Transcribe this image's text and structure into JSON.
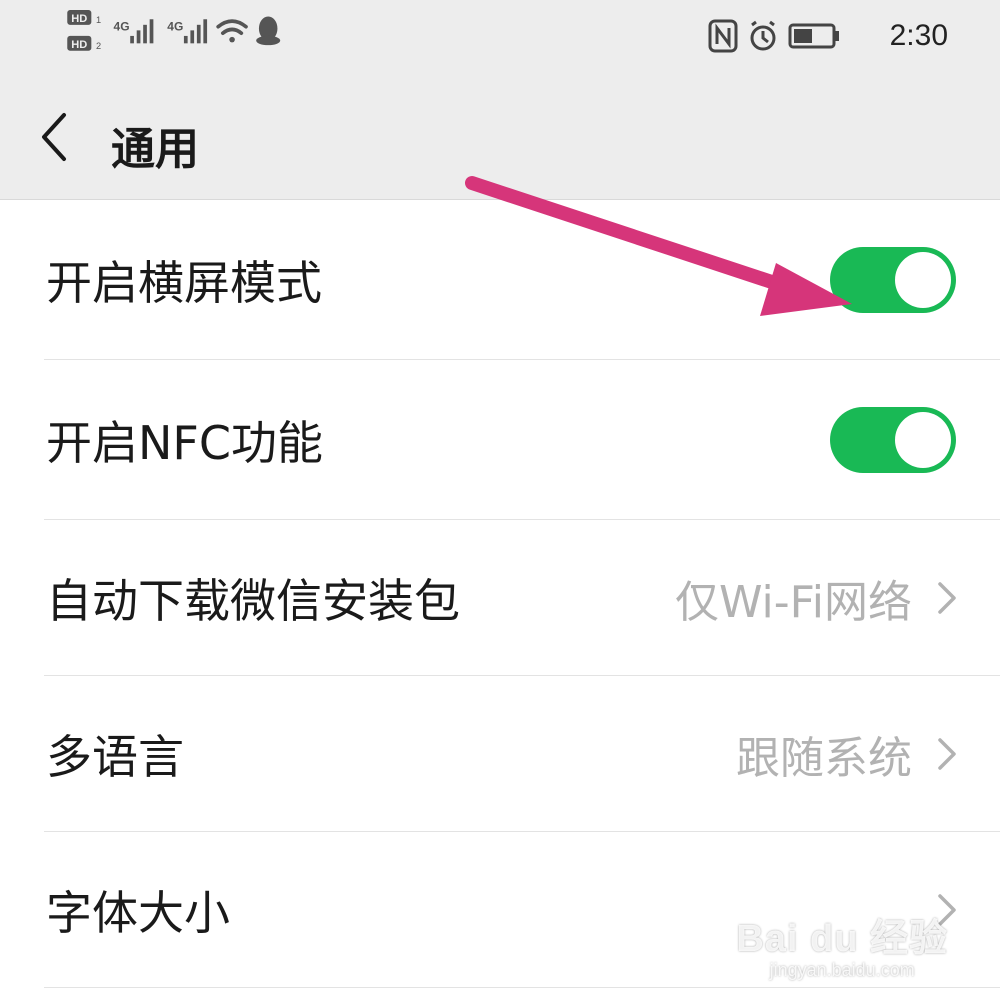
{
  "status_bar": {
    "sim1_badge": "HD",
    "sim2_badge": "HD",
    "network1": "4G",
    "network2": "4G",
    "icons": [
      "hd-icon",
      "signal-icon",
      "wifi-icon",
      "qq-icon",
      "nfc-icon",
      "alarm-icon",
      "battery-icon"
    ],
    "time": "2:30"
  },
  "header": {
    "back_icon": "chevron-left-icon",
    "title": "通用"
  },
  "settings": [
    {
      "label": "开启横屏模式",
      "type": "toggle",
      "on": true
    },
    {
      "label": "开启NFC功能",
      "type": "toggle",
      "on": true
    },
    {
      "label": "自动下载微信安装包",
      "type": "value",
      "value": "仅Wi-Fi网络"
    },
    {
      "label": "多语言",
      "type": "value",
      "value": "跟随系统"
    },
    {
      "label": "字体大小",
      "type": "value",
      "value": ""
    }
  ],
  "annotation": {
    "arrow_color": "#d6357a"
  },
  "colors": {
    "toggle_on": "#19b955",
    "header_bg": "#ededed",
    "value_text": "#b2b2b2"
  },
  "watermark": {
    "logo": "Bai du 经验",
    "url": "jingyan.baidu.com"
  }
}
